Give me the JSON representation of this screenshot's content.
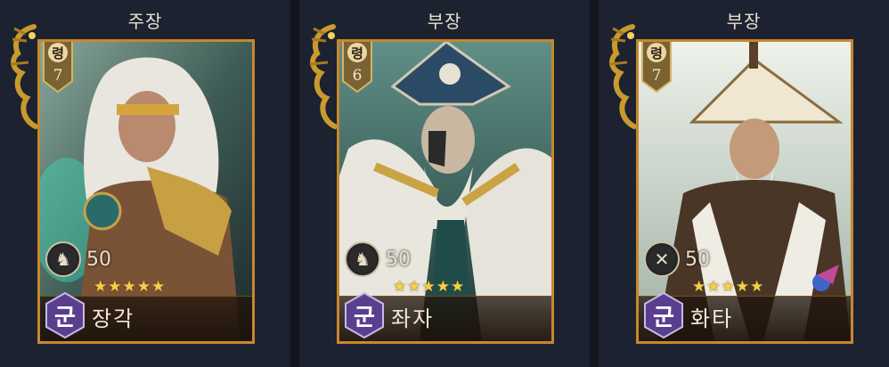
{
  "slots": [
    {
      "role": "주장",
      "rank_label": "령",
      "rank_value": "7",
      "level": "50",
      "stars": 5,
      "faction": "군",
      "name": "장각",
      "troop_icon": "horse-cavalry-icon"
    },
    {
      "role": "부장",
      "rank_label": "령",
      "rank_value": "6",
      "level": "50",
      "stars": 5,
      "faction": "군",
      "name": "좌자",
      "troop_icon": "horse-cavalry-icon"
    },
    {
      "role": "부장",
      "rank_label": "령",
      "rank_value": "7",
      "level": "50",
      "stars": 5,
      "faction": "군",
      "name": "화타",
      "troop_icon": "crossed-spears-icon"
    }
  ],
  "colors": {
    "card_border": "#c8872c",
    "faction_badge": "#5a3f8f",
    "star": "#f4cf4a",
    "panel_bg": "#1c2230"
  }
}
